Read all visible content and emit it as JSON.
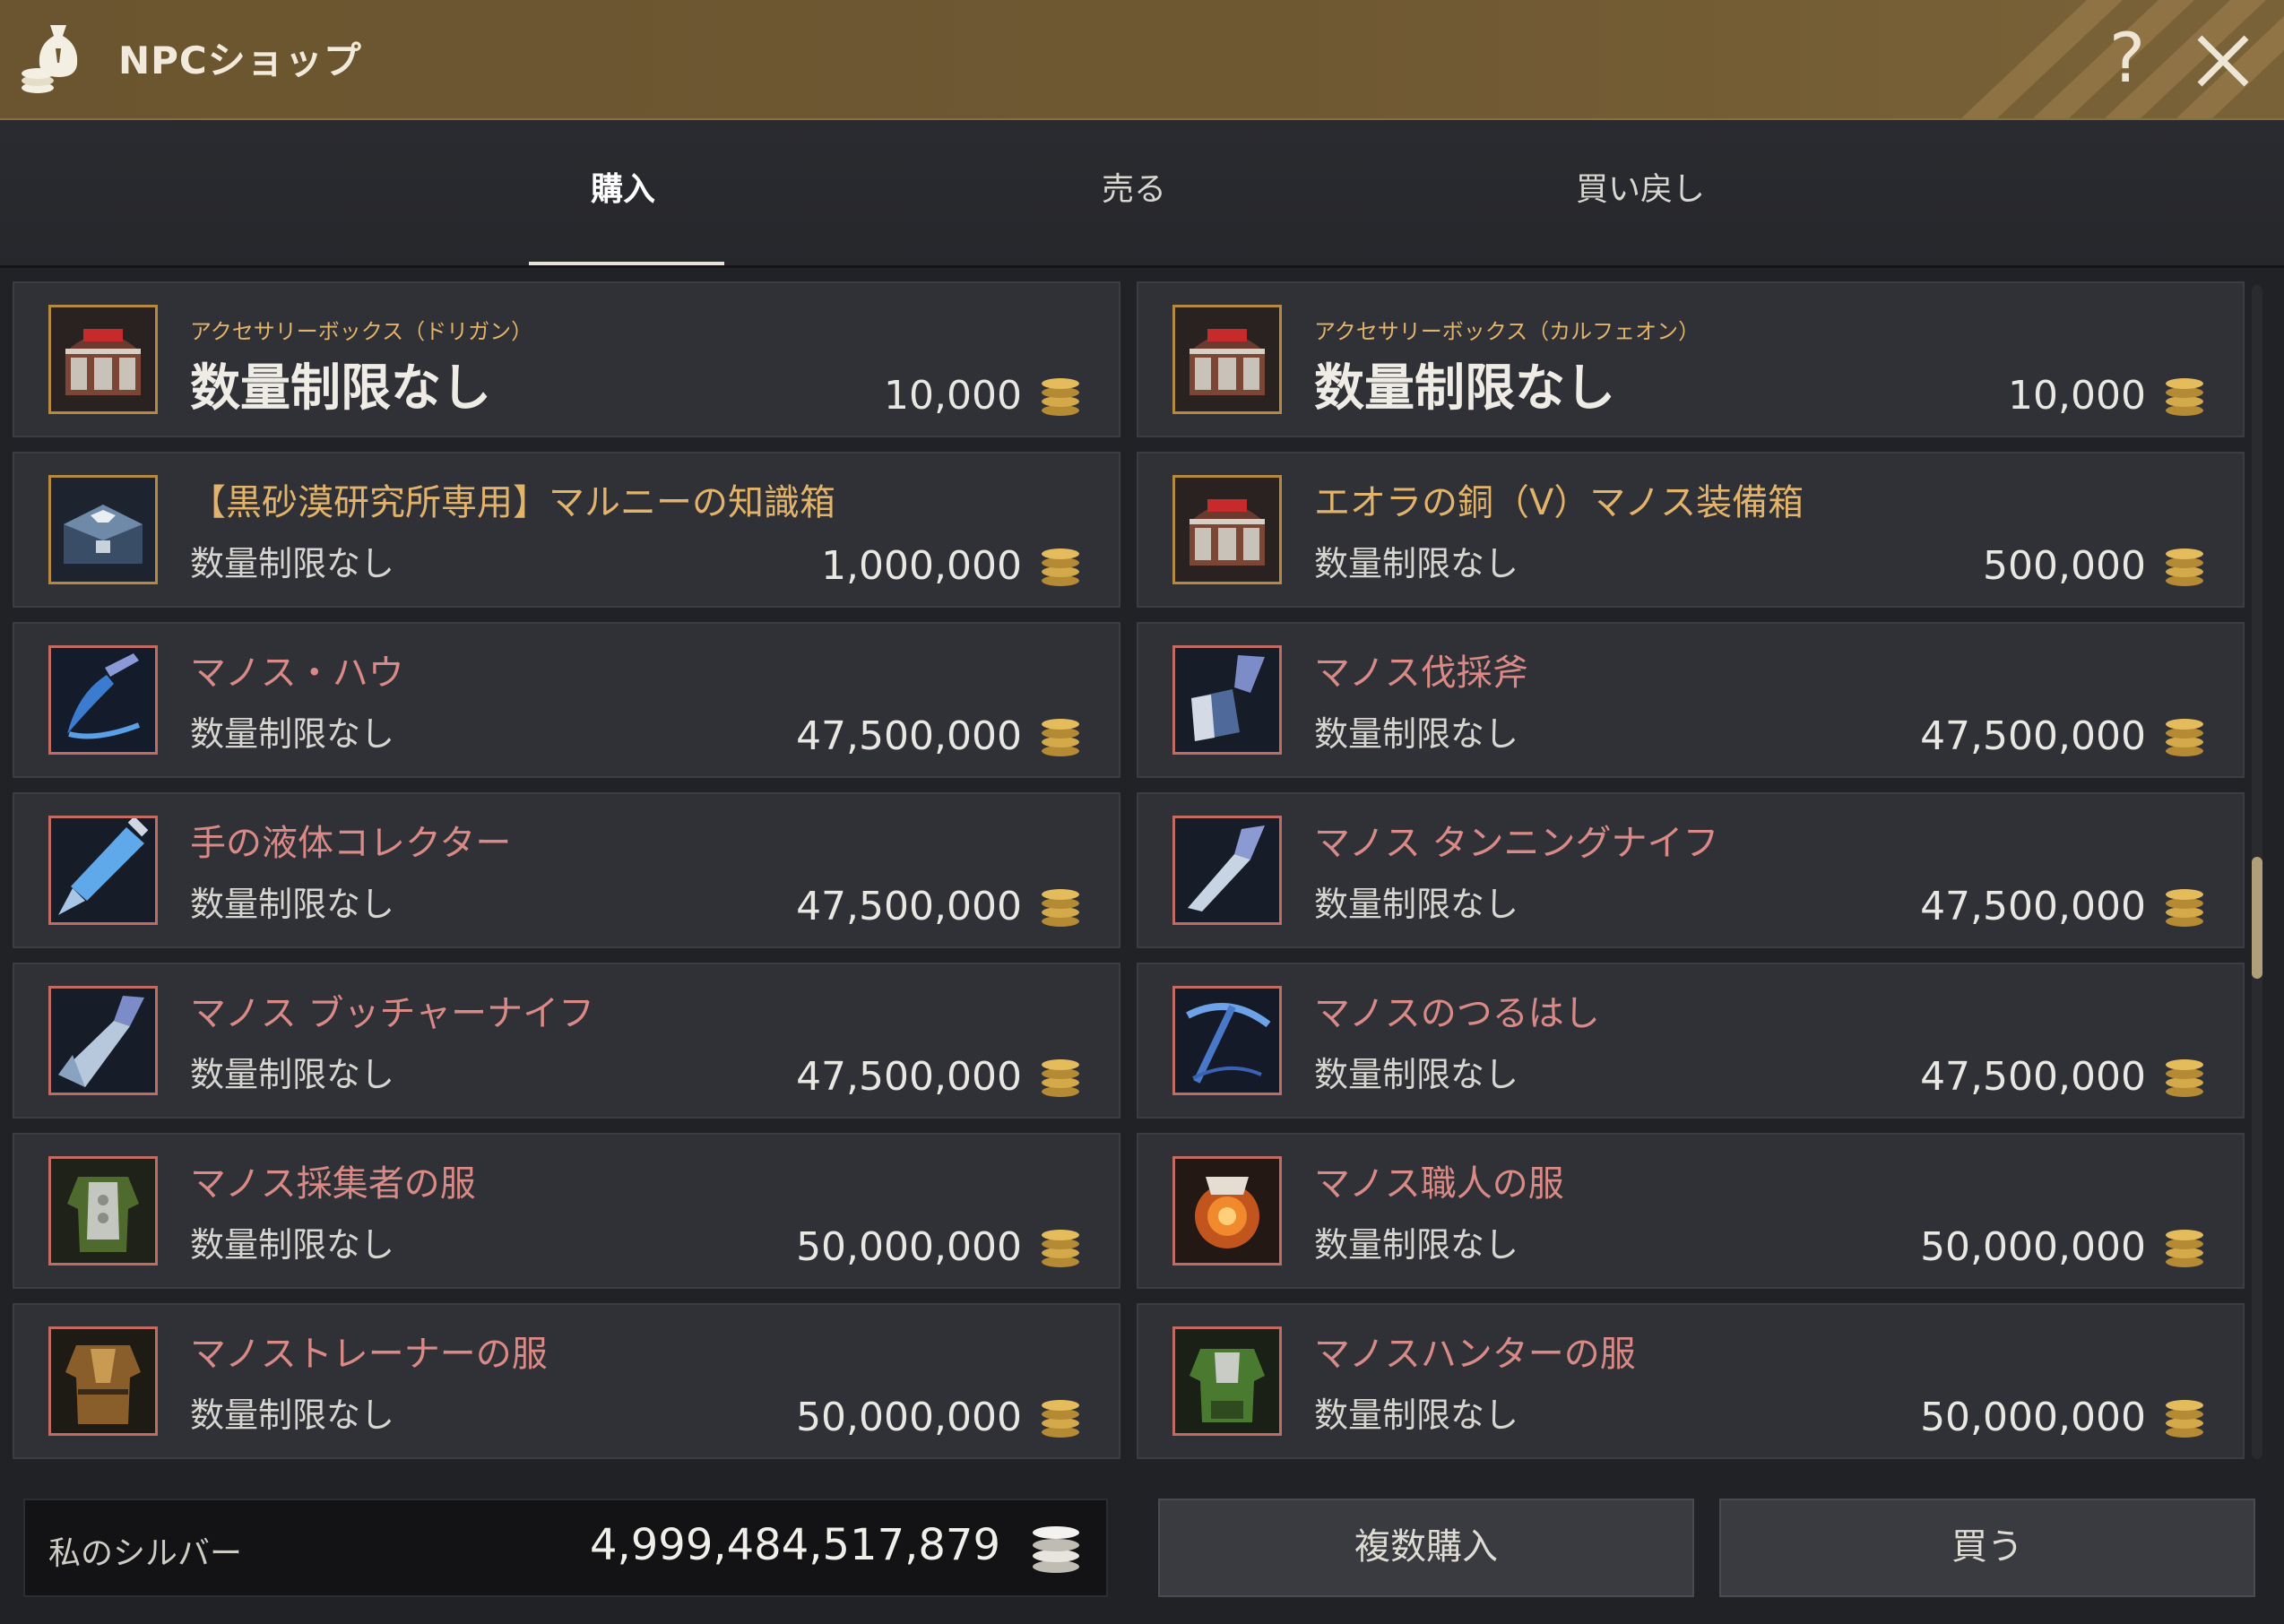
{
  "window": {
    "title": "NPCショップ",
    "help_label": "?"
  },
  "tabs": [
    {
      "label": "購入",
      "active": true
    },
    {
      "label": "売る",
      "active": false
    },
    {
      "label": "買い戻し",
      "active": false
    }
  ],
  "items": [
    {
      "name": "アクセサリーボックス（ドリガン）",
      "limit": "数量制限なし",
      "price": "10,000",
      "icon": "red-treasure-chest"
    },
    {
      "name": "アクセサリーボックス（カルフェオン）",
      "limit": "数量制限なし",
      "price": "10,000",
      "icon": "red-treasure-chest"
    },
    {
      "name": "【黒砂漠研究所専用】マルニーの知識箱",
      "limit": "数量制限なし",
      "price": "1,000,000",
      "icon": "blue-knowledge-chest"
    },
    {
      "name": "エオラの銅（V）マノス装備箱",
      "limit": "数量制限なし",
      "price": "500,000",
      "icon": "red-treasure-chest"
    },
    {
      "name": "マノス・ハウ",
      "limit": "数量制限なし",
      "price": "47,500,000",
      "icon": "manos-hoe"
    },
    {
      "name": "マノス伐採斧",
      "limit": "数量制限なし",
      "price": "47,500,000",
      "icon": "manos-axe"
    },
    {
      "name": "手の液体コレクター",
      "limit": "数量制限なし",
      "price": "47,500,000",
      "icon": "syringe"
    },
    {
      "name": "マノス タンニングナイフ",
      "limit": "数量制限なし",
      "price": "47,500,000",
      "icon": "tanning-knife"
    },
    {
      "name": "マノス ブッチャーナイフ",
      "limit": "数量制限なし",
      "price": "47,500,000",
      "icon": "butcher-knife"
    },
    {
      "name": "マノスのつるはし",
      "limit": "数量制限なし",
      "price": "47,500,000",
      "icon": "pickaxe"
    },
    {
      "name": "マノス採集者の服",
      "limit": "数量制限なし",
      "price": "50,000,000",
      "icon": "gatherer-outfit"
    },
    {
      "name": "マノス職人の服",
      "limit": "数量制限なし",
      "price": "50,000,000",
      "icon": "craftsman-outfit"
    },
    {
      "name": "マノストレーナーの服",
      "limit": "数量制限なし",
      "price": "50,000,000",
      "icon": "trainer-outfit"
    },
    {
      "name": "マノスハンターの服",
      "limit": "数量制限なし",
      "price": "50,000,000",
      "icon": "hunter-outfit"
    }
  ],
  "footer": {
    "silver_label": "私のシルバー",
    "silver_value": "4,999,484,517,879",
    "multi_buy_label": "複数購入",
    "buy_label": "買う"
  },
  "colors": {
    "title_bar": "#6e5832",
    "item_name_gold": "#e2b36a",
    "item_name_red": "#d98a86",
    "card_bg": "#303136",
    "scroll_thumb": "#b0a079"
  }
}
